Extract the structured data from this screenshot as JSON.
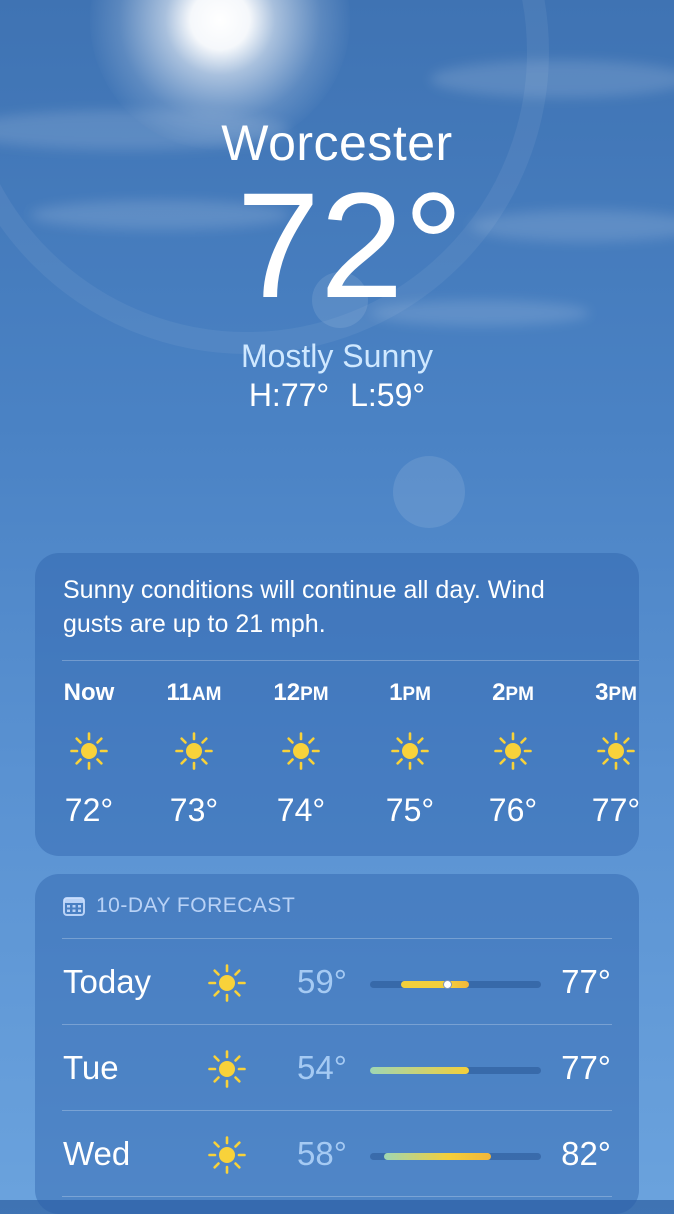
{
  "location": {
    "city": "Worcester",
    "temperature": "72°",
    "condition": "Mostly Sunny",
    "high": "H:77°",
    "low": "L:59°"
  },
  "hourly": {
    "summary": "Sunny conditions will continue all day. Wind gusts are up to 21 mph.",
    "items": [
      {
        "time": "Now",
        "ampm": "",
        "icon": "sun-icon",
        "temp": "72°"
      },
      {
        "time": "11",
        "ampm": "AM",
        "icon": "sun-icon",
        "temp": "73°"
      },
      {
        "time": "12",
        "ampm": "PM",
        "icon": "sun-icon",
        "temp": "74°"
      },
      {
        "time": "1",
        "ampm": "PM",
        "icon": "sun-icon",
        "temp": "75°"
      },
      {
        "time": "2",
        "ampm": "PM",
        "icon": "sun-icon",
        "temp": "76°"
      },
      {
        "time": "3",
        "ampm": "PM",
        "icon": "sun-icon",
        "temp": "77°"
      }
    ]
  },
  "daily": {
    "title": "10-DAY FORECAST",
    "days": [
      {
        "day": "Today",
        "icon": "sun-icon",
        "low": "59°",
        "high": "77°",
        "range_start": 0.18,
        "range_end": 0.58,
        "current": 0.45
      },
      {
        "day": "Tue",
        "icon": "sun-icon",
        "low": "54°",
        "high": "77°",
        "range_start": 0.0,
        "range_end": 0.58
      },
      {
        "day": "Wed",
        "icon": "sun-icon",
        "low": "58°",
        "high": "82°",
        "range_start": 0.08,
        "range_end": 0.71
      }
    ]
  },
  "colors": {
    "sun": "#f8d23a",
    "low_temp": "#aacdf5",
    "bar_cool": "#9fd6b3",
    "bar_warm": "#f3cf3b",
    "bar_hot": "#f2b63a"
  }
}
